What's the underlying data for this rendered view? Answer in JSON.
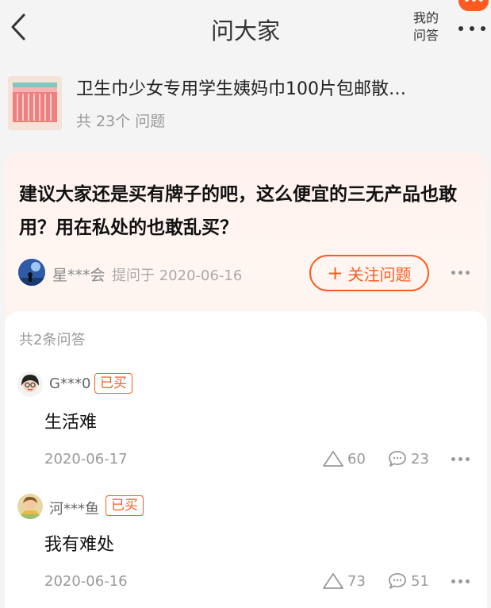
{
  "header": {
    "title": "问大家",
    "my_qa": [
      "我的",
      "问答"
    ],
    "icons": {
      "back": "chevron-left-icon",
      "more": "more-dots-icon"
    },
    "accent_color": "#ff5a1f"
  },
  "product": {
    "name": "卫生巾少女专用学生姨妈巾100片包邮散…",
    "question_count": "共 23个 问题"
  },
  "question": {
    "text": "建议大家还是买有牌子的吧，这么便宜的三无产品也敢用？用在私处的也敢乱买？",
    "asker": "星***会",
    "asked_at": "提问于 2020-06-16",
    "follow_label": "关注问题"
  },
  "answers_summary": "共2条问答",
  "answers": [
    {
      "user": "G***0",
      "badge": "已买",
      "text": "生活难",
      "date": "2020-06-17",
      "likes": "60",
      "comments": "23"
    },
    {
      "user": "河***鱼",
      "badge": "已买",
      "text": "我有难处",
      "date": "2020-06-16",
      "likes": "73",
      "comments": "51"
    }
  ]
}
